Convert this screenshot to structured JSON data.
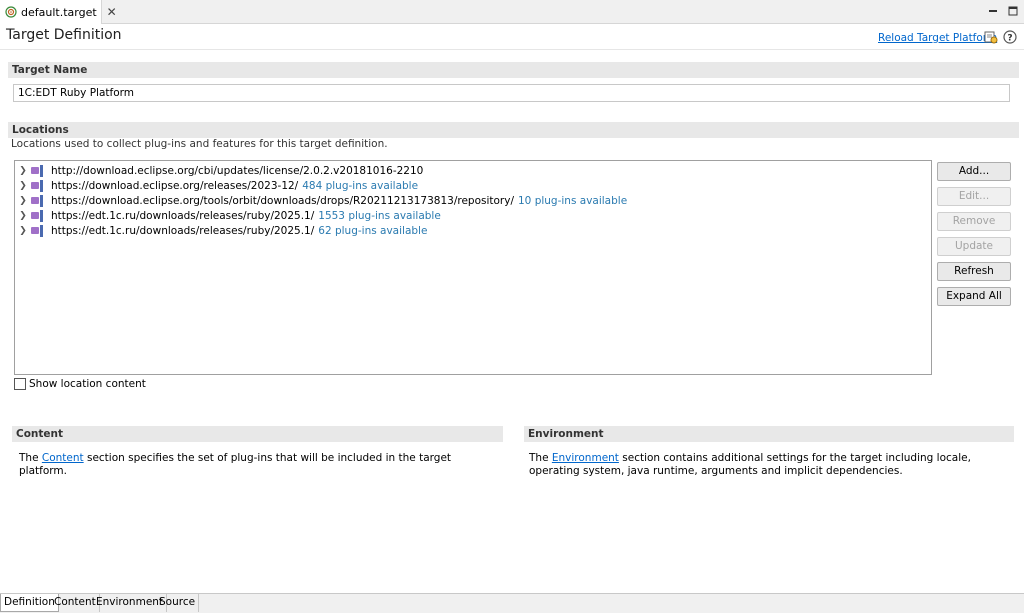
{
  "editor": {
    "tab_title": "default.target",
    "close_glyph": "✕",
    "minimize_glyph": "—",
    "maximize_glyph": "☐"
  },
  "header": {
    "title": "Target Definition",
    "reload_link": "Reload Target Platform",
    "icons": [
      "target-icon",
      "help-icon"
    ]
  },
  "target_name": {
    "label": "Target Name",
    "value": "1C:EDT Ruby Platform"
  },
  "locations": {
    "label": "Locations",
    "description": "Locations used to collect plug-ins and features for this target definition.",
    "items": [
      {
        "url": "http://download.eclipse.org/cbi/updates/license/2.0.2.v20181016-2210",
        "count": ""
      },
      {
        "url": "https://download.eclipse.org/releases/2023-12/",
        "count": "484 plug-ins available"
      },
      {
        "url": "https://download.eclipse.org/tools/orbit/downloads/drops/R20211213173813/repository/",
        "count": "10 plug-ins available"
      },
      {
        "url": "https://edt.1c.ru/downloads/releases/ruby/2025.1/",
        "count": "1553 plug-ins available"
      },
      {
        "url": "https://edt.1c.ru/downloads/releases/ruby/2025.1/",
        "count": "62 plug-ins available"
      }
    ],
    "buttons": {
      "add": "Add...",
      "edit": "Edit...",
      "remove": "Remove",
      "update": "Update",
      "refresh": "Refresh",
      "expand_all": "Expand All"
    },
    "show_content_label": "Show location content",
    "show_content_checked": false
  },
  "content": {
    "label": "Content",
    "text_before": "The ",
    "link": "Content",
    "text_after": " section specifies the set of plug-ins that will be included in the target platform."
  },
  "environment": {
    "label": "Environment",
    "text_before": "The ",
    "link": "Environment",
    "text_after": " section contains additional settings for the target including locale, operating system, java runtime, arguments and implicit dependencies."
  },
  "bottom_tabs": [
    {
      "label": "Definition",
      "active": true
    },
    {
      "label": "Content",
      "active": false
    },
    {
      "label": "Environment",
      "active": false
    },
    {
      "label": "Source",
      "active": false
    }
  ],
  "colors": {
    "link": "#0066cc",
    "count": "#2a7ab0",
    "section_bar": "#e8e8e8"
  }
}
